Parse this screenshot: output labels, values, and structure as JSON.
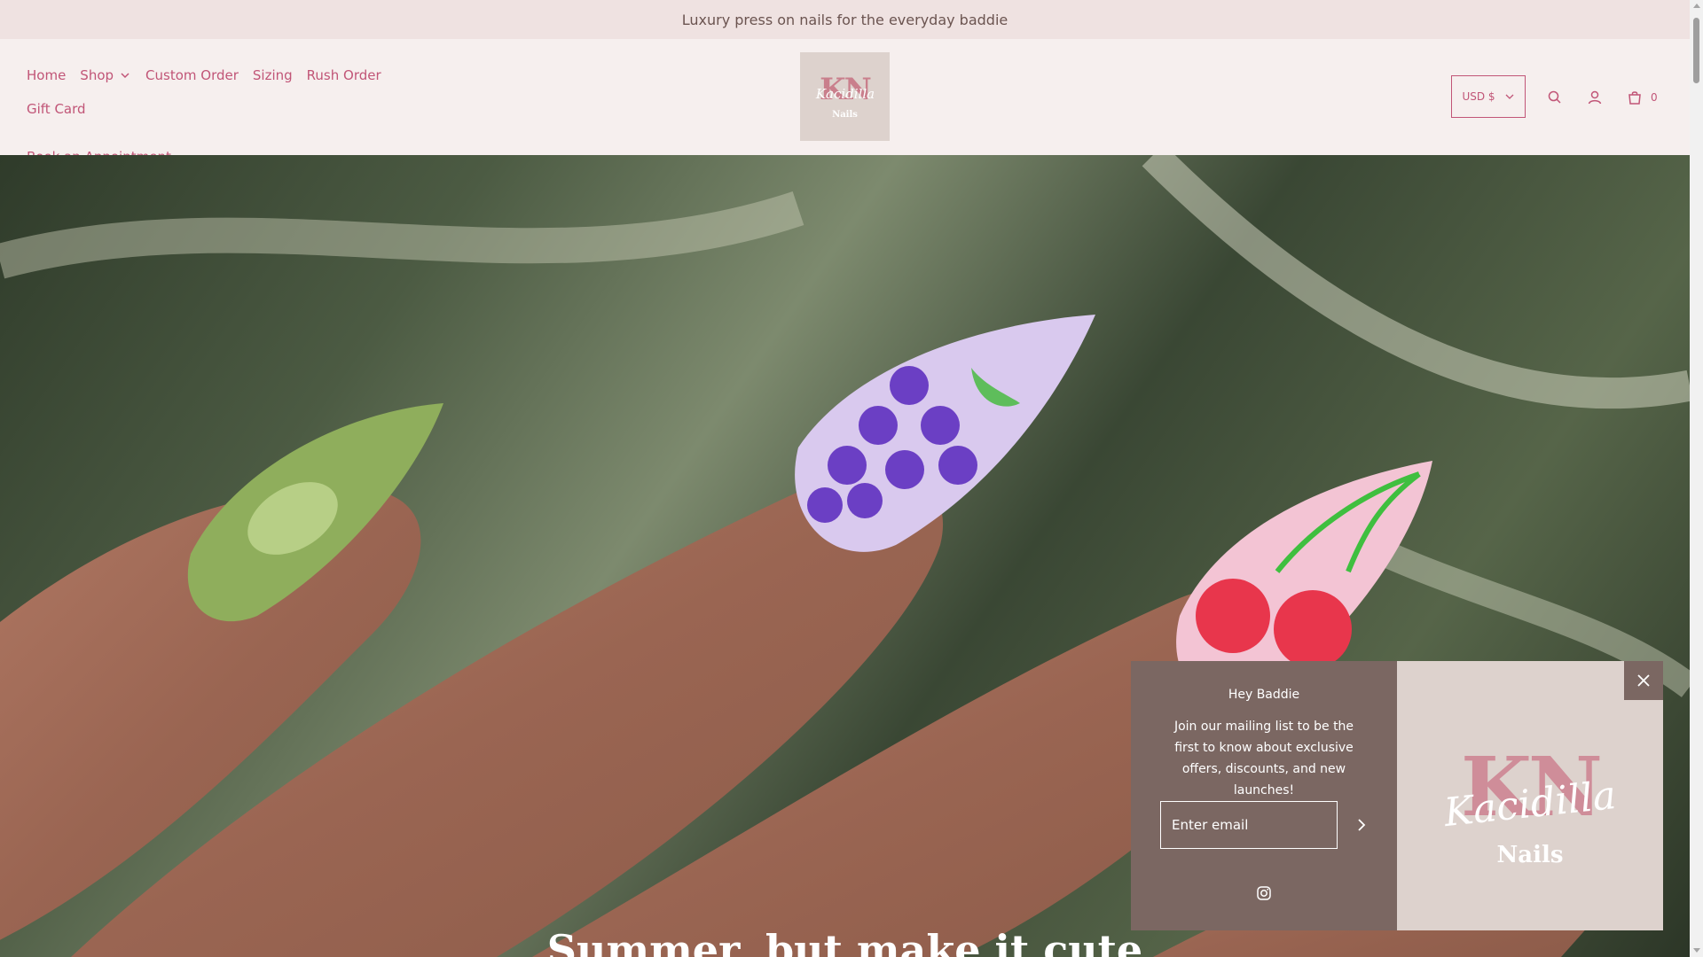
{
  "announcement": {
    "text": "Luxury press on nails for the everyday baddie"
  },
  "nav": {
    "items": [
      {
        "label": "Home"
      },
      {
        "label": "Shop"
      },
      {
        "label": "Custom Order"
      },
      {
        "label": "Sizing"
      },
      {
        "label": "Rush Order"
      },
      {
        "label": "Gift Card"
      },
      {
        "label": "Book an Appointment"
      }
    ]
  },
  "logo": {
    "monogram": "KN",
    "script": "Kacidilla",
    "word": "Nails"
  },
  "header": {
    "currency": "USD $",
    "cart_count": "0"
  },
  "hero": {
    "heading": "Summer, but make it cute"
  },
  "popup": {
    "title": "Hey Baddie",
    "text": "Join our mailing list to be the first to know about exclusive offers, discounts, and new launches!",
    "email_placeholder": "Enter email",
    "logo_monogram": "KN",
    "logo_script": "Kacidilla",
    "logo_word": "Nails"
  },
  "colors": {
    "accent": "#c15577",
    "announcement_bg": "#efe2e1",
    "header_bg": "#f6efee",
    "popup_bg": "#7b6762",
    "popup_logo_bg": "#ddd2cd"
  },
  "icons": [
    "chevron-down-icon",
    "search-icon",
    "account-icon",
    "cart-icon",
    "instagram-icon",
    "close-icon",
    "arrow-right-icon"
  ]
}
